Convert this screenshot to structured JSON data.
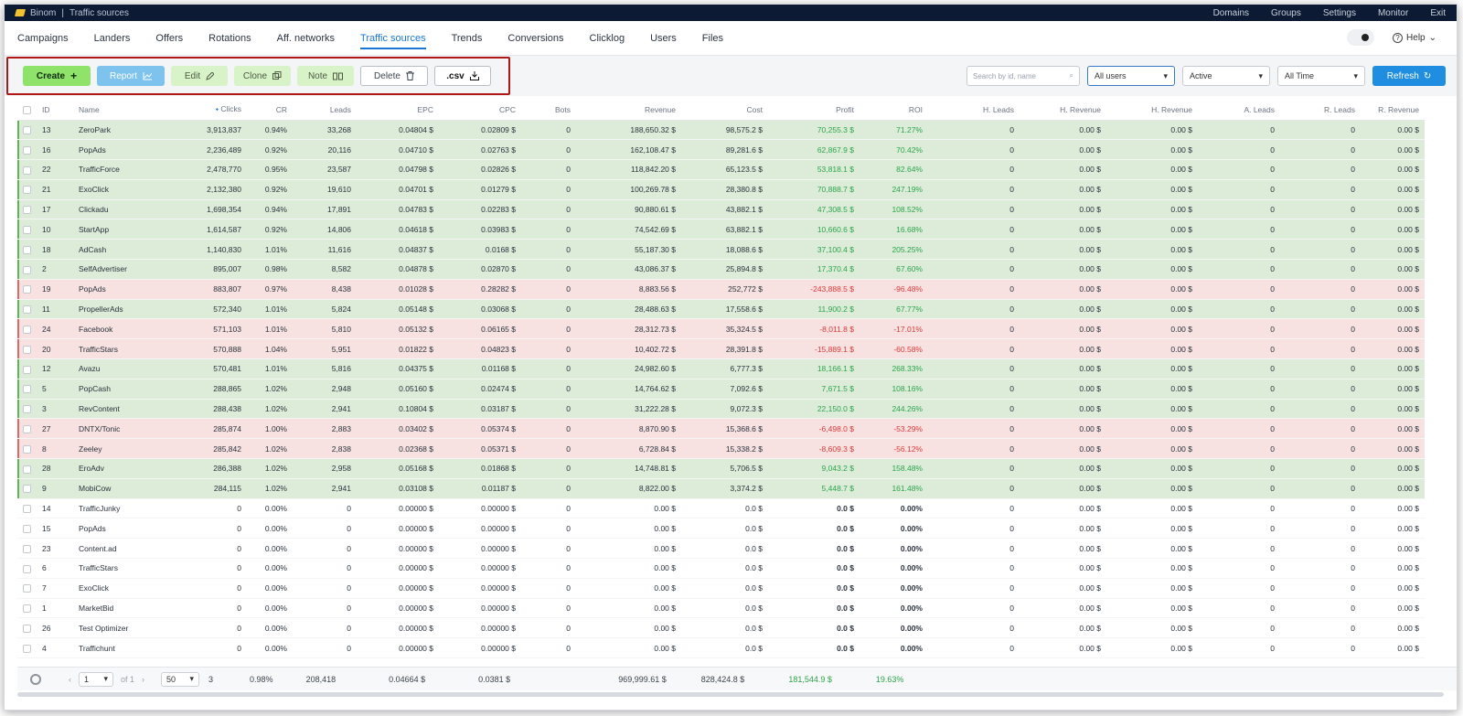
{
  "titlebar": {
    "app": "Binom",
    "section": "Traffic sources",
    "menu": [
      "Domains",
      "Groups",
      "Settings",
      "Monitor",
      "Exit"
    ]
  },
  "nav": {
    "tabs": [
      "Campaigns",
      "Landers",
      "Offers",
      "Rotations",
      "Aff. networks",
      "Traffic sources",
      "Trends",
      "Conversions",
      "Clicklog",
      "Users",
      "Files"
    ],
    "active_tab": "Traffic sources",
    "help_label": "Help"
  },
  "toolbar": {
    "create": "Create",
    "report": "Report",
    "edit": "Edit",
    "clone": "Clone",
    "note": "Note",
    "delete": "Delete",
    "csv": ".csv",
    "search_placeholder": "Search by id, name",
    "users_filter": "All users",
    "status_filter": "Active",
    "date_filter": "All Time",
    "refresh": "Refresh"
  },
  "colors": {
    "create": "#8fe36b",
    "report": "#7dc3ee",
    "refresh": "#1f8de0",
    "highlight_box": "#b01818",
    "positive": "#2ca44a",
    "negative": "#d83a3a"
  },
  "table": {
    "columns": [
      "ID",
      "Name",
      "Clicks",
      "CR",
      "Leads",
      "EPC",
      "CPC",
      "Bots",
      "Revenue",
      "Cost",
      "Profit",
      "ROI",
      "H. Leads",
      "H. Revenue",
      "H. Revenue",
      "A. Leads",
      "R. Leads",
      "R. Revenue"
    ],
    "rows": [
      {
        "status": "g",
        "cells": [
          "13",
          "ZeroPark",
          "3,913,837",
          "0.94%",
          "33,268",
          "0.04804 $",
          "0.02809 $",
          "0",
          "188,650.32 $",
          "98,575.2 $",
          "70,255.3 $",
          "71.27%",
          "0",
          "0.00 $",
          "0.00 $",
          "0",
          "0",
          "0.00 $"
        ]
      },
      {
        "status": "g",
        "cells": [
          "16",
          "PopAds",
          "2,236,489",
          "0.92%",
          "20,116",
          "0.04710 $",
          "0.02763 $",
          "0",
          "162,108.47 $",
          "89,281.6 $",
          "62,867.9 $",
          "70.42%",
          "0",
          "0.00 $",
          "0.00 $",
          "0",
          "0",
          "0.00 $"
        ]
      },
      {
        "status": "g",
        "cells": [
          "22",
          "TrafficForce",
          "2,478,770",
          "0.95%",
          "23,587",
          "0.04798 $",
          "0.02826 $",
          "0",
          "118,842.20 $",
          "65,123.5 $",
          "53,818.1 $",
          "82.64%",
          "0",
          "0.00 $",
          "0.00 $",
          "0",
          "0",
          "0.00 $"
        ]
      },
      {
        "status": "g",
        "cells": [
          "21",
          "ExoClick",
          "2,132,380",
          "0.92%",
          "19,610",
          "0.04701 $",
          "0.01279 $",
          "0",
          "100,269.78 $",
          "28,380.8 $",
          "70,888.7 $",
          "247.19%",
          "0",
          "0.00 $",
          "0.00 $",
          "0",
          "0",
          "0.00 $"
        ]
      },
      {
        "status": "g",
        "cells": [
          "17",
          "Clickadu",
          "1,698,354",
          "0.94%",
          "17,891",
          "0.04783 $",
          "0.02283 $",
          "0",
          "90,880.61 $",
          "43,882.1 $",
          "47,308.5 $",
          "108.52%",
          "0",
          "0.00 $",
          "0.00 $",
          "0",
          "0",
          "0.00 $"
        ]
      },
      {
        "status": "g",
        "cells": [
          "10",
          "StartApp",
          "1,614,587",
          "0.92%",
          "14,806",
          "0.04618 $",
          "0.03983 $",
          "0",
          "74,542.69 $",
          "63,882.1 $",
          "10,660.6 $",
          "16.68%",
          "0",
          "0.00 $",
          "0.00 $",
          "0",
          "0",
          "0.00 $"
        ]
      },
      {
        "status": "g",
        "cells": [
          "18",
          "AdCash",
          "1,140,830",
          "1.01%",
          "11,616",
          "0.04837 $",
          "0.0168 $",
          "0",
          "55,187.30 $",
          "18,088.6 $",
          "37,100.4 $",
          "205.25%",
          "0",
          "0.00 $",
          "0.00 $",
          "0",
          "0",
          "0.00 $"
        ]
      },
      {
        "status": "g",
        "cells": [
          "2",
          "SelfAdvertiser",
          "895,007",
          "0.98%",
          "8,582",
          "0.04878 $",
          "0.02870 $",
          "0",
          "43,086.37 $",
          "25,894.8 $",
          "17,370.4 $",
          "67.60%",
          "0",
          "0.00 $",
          "0.00 $",
          "0",
          "0",
          "0.00 $"
        ]
      },
      {
        "status": "r",
        "cells": [
          "19",
          "PopAds",
          "883,807",
          "0.97%",
          "8,438",
          "0.01028 $",
          "0.28282 $",
          "0",
          "8,883.56 $",
          "252,772 $",
          "-243,888.5 $",
          "-96.48%",
          "0",
          "0.00 $",
          "0.00 $",
          "0",
          "0",
          "0.00 $"
        ]
      },
      {
        "status": "g",
        "cells": [
          "11",
          "PropellerAds",
          "572,340",
          "1.01%",
          "5,824",
          "0.05148 $",
          "0.03068 $",
          "0",
          "28,488.63 $",
          "17,558.6 $",
          "11,900.2 $",
          "67.77%",
          "0",
          "0.00 $",
          "0.00 $",
          "0",
          "0",
          "0.00 $"
        ]
      },
      {
        "status": "r",
        "cells": [
          "24",
          "Facebook",
          "571,103",
          "1.01%",
          "5,810",
          "0.05132 $",
          "0.06165 $",
          "0",
          "28,312.73 $",
          "35,324.5 $",
          "-8,011.8 $",
          "-17.01%",
          "0",
          "0.00 $",
          "0.00 $",
          "0",
          "0",
          "0.00 $"
        ]
      },
      {
        "status": "r",
        "cells": [
          "20",
          "TrafficStars",
          "570,888",
          "1.04%",
          "5,951",
          "0.01822 $",
          "0.04823 $",
          "0",
          "10,402.72 $",
          "28,391.8 $",
          "-15,889.1 $",
          "-60.58%",
          "0",
          "0.00 $",
          "0.00 $",
          "0",
          "0",
          "0.00 $"
        ]
      },
      {
        "status": "g",
        "cells": [
          "12",
          "Avazu",
          "570,481",
          "1.01%",
          "5,816",
          "0.04375 $",
          "0.01168 $",
          "0",
          "24,982.60 $",
          "6,777.3 $",
          "18,166.1 $",
          "268.33%",
          "0",
          "0.00 $",
          "0.00 $",
          "0",
          "0",
          "0.00 $"
        ]
      },
      {
        "status": "g",
        "cells": [
          "5",
          "PopCash",
          "288,865",
          "1.02%",
          "2,948",
          "0.05160 $",
          "0.02474 $",
          "0",
          "14,764.62 $",
          "7,092.6 $",
          "7,671.5 $",
          "108.16%",
          "0",
          "0.00 $",
          "0.00 $",
          "0",
          "0",
          "0.00 $"
        ]
      },
      {
        "status": "g",
        "cells": [
          "3",
          "RevContent",
          "288,438",
          "1.02%",
          "2,941",
          "0.10804 $",
          "0.03187 $",
          "0",
          "31,222.28 $",
          "9,072.3 $",
          "22,150.0 $",
          "244.26%",
          "0",
          "0.00 $",
          "0.00 $",
          "0",
          "0",
          "0.00 $"
        ]
      },
      {
        "status": "r",
        "cells": [
          "27",
          "DNTX/Tonic",
          "285,874",
          "1.00%",
          "2,883",
          "0.03402 $",
          "0.05374 $",
          "0",
          "8,870.90 $",
          "15,368.6 $",
          "-6,498.0 $",
          "-53.29%",
          "0",
          "0.00 $",
          "0.00 $",
          "0",
          "0",
          "0.00 $"
        ]
      },
      {
        "status": "r",
        "cells": [
          "8",
          "Zeeley",
          "285,842",
          "1.02%",
          "2,838",
          "0.02368 $",
          "0.05371 $",
          "0",
          "6,728.84 $",
          "15,338.2 $",
          "-8,609.3 $",
          "-56.12%",
          "0",
          "0.00 $",
          "0.00 $",
          "0",
          "0",
          "0.00 $"
        ]
      },
      {
        "status": "g",
        "cells": [
          "28",
          "EroAdv",
          "286,388",
          "1.02%",
          "2,958",
          "0.05168 $",
          "0.01868 $",
          "0",
          "14,748.81 $",
          "5,706.5 $",
          "9,043.2 $",
          "158.48%",
          "0",
          "0.00 $",
          "0.00 $",
          "0",
          "0",
          "0.00 $"
        ]
      },
      {
        "status": "g",
        "cells": [
          "9",
          "MobiCow",
          "284,115",
          "1.02%",
          "2,941",
          "0.03108 $",
          "0.01187 $",
          "0",
          "8,822.00 $",
          "3,374.2 $",
          "5,448.7 $",
          "161.48%",
          "0",
          "0.00 $",
          "0.00 $",
          "0",
          "0",
          "0.00 $"
        ]
      },
      {
        "status": "n",
        "cells": [
          "14",
          "TrafficJunky",
          "0",
          "0.00%",
          "0",
          "0.00000 $",
          "0.00000 $",
          "0",
          "0.00 $",
          "0.0 $",
          "0.0 $",
          "0.00%",
          "0",
          "0.00 $",
          "0.00 $",
          "0",
          "0",
          "0.00 $"
        ]
      },
      {
        "status": "n",
        "cells": [
          "15",
          "PopAds",
          "0",
          "0.00%",
          "0",
          "0.00000 $",
          "0.00000 $",
          "0",
          "0.00 $",
          "0.0 $",
          "0.0 $",
          "0.00%",
          "0",
          "0.00 $",
          "0.00 $",
          "0",
          "0",
          "0.00 $"
        ]
      },
      {
        "status": "n",
        "cells": [
          "23",
          "Content.ad",
          "0",
          "0.00%",
          "0",
          "0.00000 $",
          "0.00000 $",
          "0",
          "0.00 $",
          "0.0 $",
          "0.0 $",
          "0.00%",
          "0",
          "0.00 $",
          "0.00 $",
          "0",
          "0",
          "0.00 $"
        ]
      },
      {
        "status": "n",
        "cells": [
          "6",
          "TrafficStars",
          "0",
          "0.00%",
          "0",
          "0.00000 $",
          "0.00000 $",
          "0",
          "0.00 $",
          "0.0 $",
          "0.0 $",
          "0.00%",
          "0",
          "0.00 $",
          "0.00 $",
          "0",
          "0",
          "0.00 $"
        ]
      },
      {
        "status": "n",
        "cells": [
          "7",
          "ExoClick",
          "0",
          "0.00%",
          "0",
          "0.00000 $",
          "0.00000 $",
          "0",
          "0.00 $",
          "0.0 $",
          "0.0 $",
          "0.00%",
          "0",
          "0.00 $",
          "0.00 $",
          "0",
          "0",
          "0.00 $"
        ]
      },
      {
        "status": "n",
        "cells": [
          "1",
          "MarketBid",
          "0",
          "0.00%",
          "0",
          "0.00000 $",
          "0.00000 $",
          "0",
          "0.00 $",
          "0.0 $",
          "0.0 $",
          "0.00%",
          "0",
          "0.00 $",
          "0.00 $",
          "0",
          "0",
          "0.00 $"
        ]
      },
      {
        "status": "n",
        "cells": [
          "26",
          "Test Optimizer",
          "0",
          "0.00%",
          "0",
          "0.00000 $",
          "0.00000 $",
          "0",
          "0.00 $",
          "0.0 $",
          "0.0 $",
          "0.00%",
          "0",
          "0.00 $",
          "0.00 $",
          "0",
          "0",
          "0.00 $"
        ]
      },
      {
        "status": "n",
        "cells": [
          "4",
          "Traffichunt",
          "0",
          "0.00%",
          "0",
          "0.00000 $",
          "0.00000 $",
          "0",
          "0.00 $",
          "0.0 $",
          "0.0 $",
          "0.00%",
          "0",
          "0.00 $",
          "0.00 $",
          "0",
          "0",
          "0.00 $"
        ]
      }
    ]
  },
  "footer": {
    "page": "1",
    "of": "of 1",
    "per_page": "50",
    "count": "3",
    "cr": "0.98%",
    "leads": "208,418",
    "epc": "0.04664 $",
    "cpc": "0.0381 $",
    "revenue": "969,999.61 $",
    "cost": "828,424.8 $",
    "profit": "181,544.9 $",
    "roi": "19.63%"
  }
}
